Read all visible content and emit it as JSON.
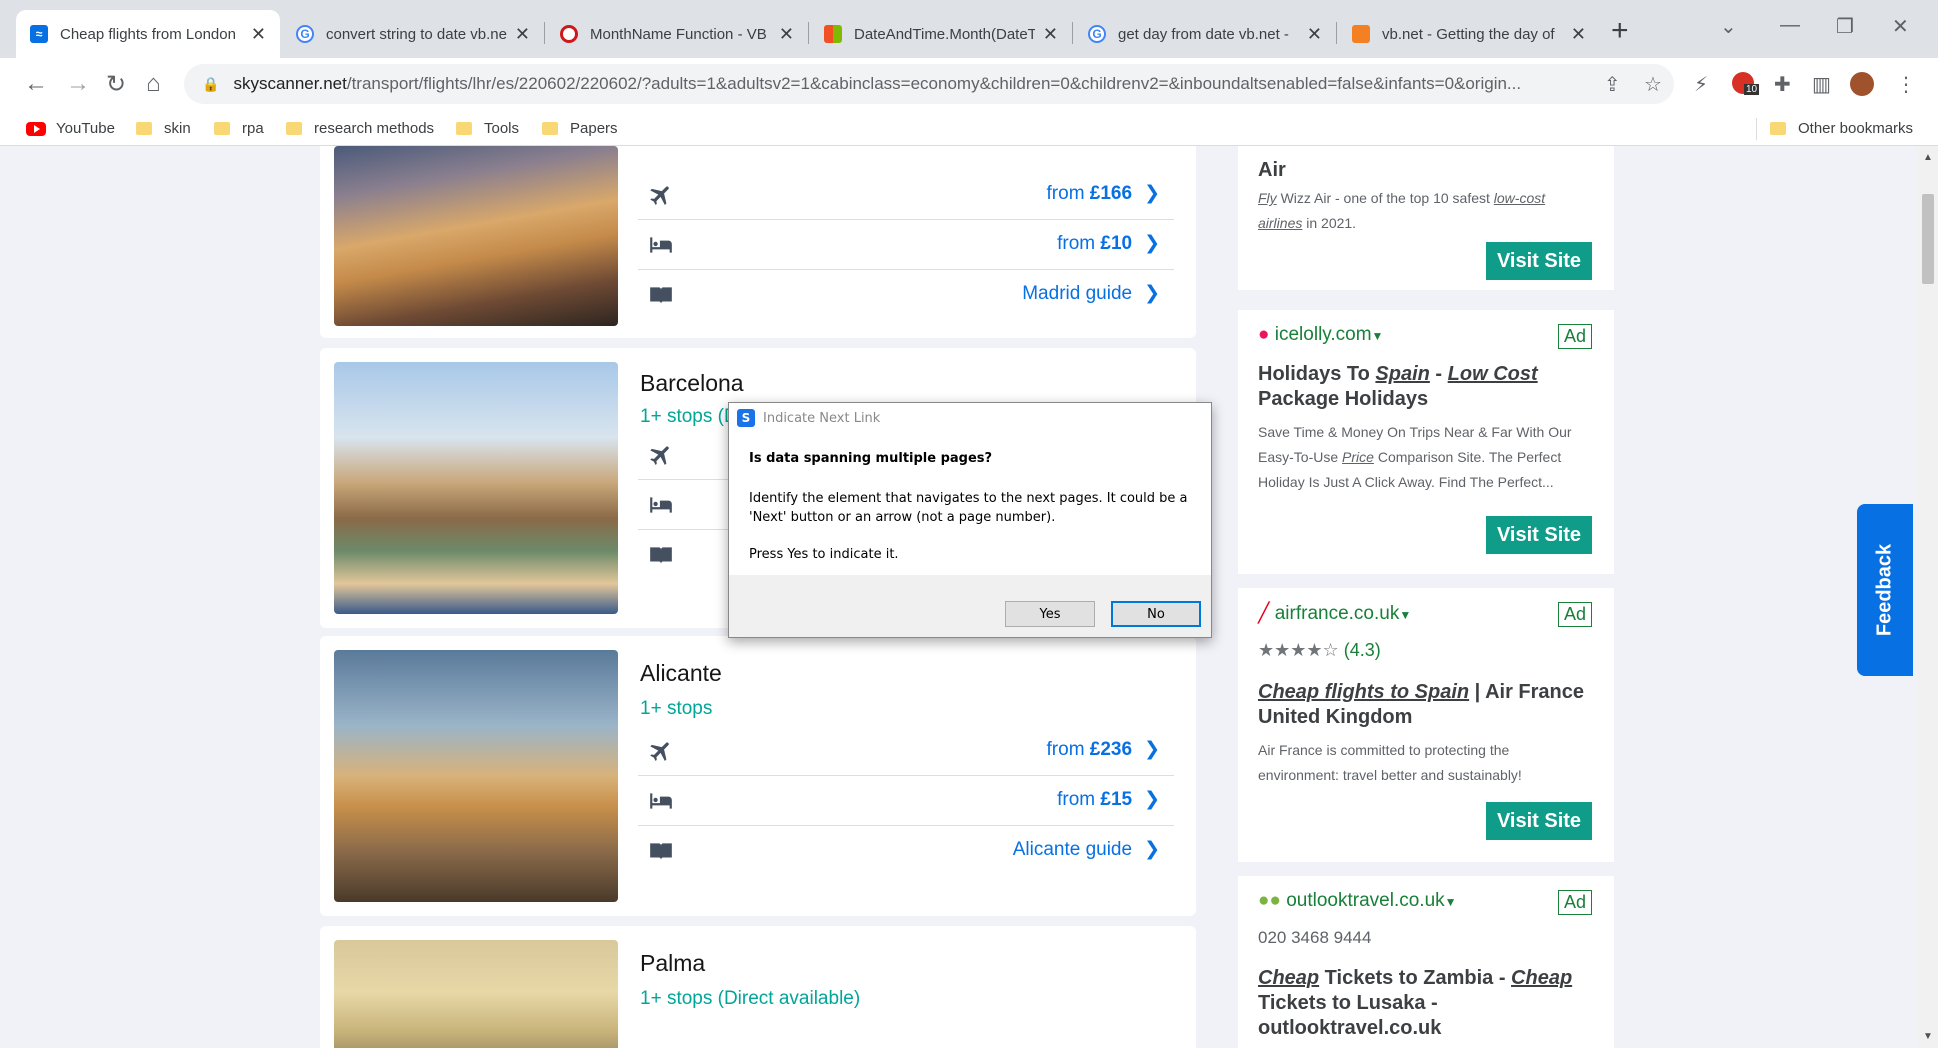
{
  "browser": {
    "tabs": [
      {
        "label": "Cheap flights from London",
        "favicon": "skyscanner-icon",
        "active": true
      },
      {
        "label": "convert string to date vb.ne",
        "favicon": "google-icon",
        "active": false
      },
      {
        "label": "MonthName Function - VB",
        "favicon": "opera-icon",
        "active": false
      },
      {
        "label": "DateAndTime.Month(DateT",
        "favicon": "microsoft-icon",
        "active": false
      },
      {
        "label": "get day from date vb.net -",
        "favicon": "google-icon",
        "active": false
      },
      {
        "label": "vb.net - Getting the day of",
        "favicon": "stackoverflow-icon",
        "active": false
      }
    ],
    "url_host": "skyscanner.net",
    "url_path": "/transport/flights/lhr/es/220602/220602/?adults=1&adultsv2=1&cabinclass=economy&children=0&childrenv2=&inboundaltsenabled=false&infants=0&origin...",
    "extension_badge": "10",
    "bookmarks": [
      "YouTube",
      "skin",
      "rpa",
      "research methods",
      "Tools",
      "Papers"
    ],
    "other_bookmarks": "Other bookmarks"
  },
  "destinations": [
    {
      "city": "",
      "stops": "",
      "flight": "from ",
      "flight_price": "£166",
      "hotel": "from ",
      "hotel_price": "£10",
      "guide": "Madrid guide"
    },
    {
      "city": "Barcelona",
      "stops": "1+ stops (D",
      "flight": "",
      "flight_price": "",
      "hotel": "",
      "hotel_price": "",
      "guide": ""
    },
    {
      "city": "Alicante",
      "stops": "1+ stops",
      "flight": "from ",
      "flight_price": "£236",
      "hotel": "from ",
      "hotel_price": "£15",
      "guide": "Alicante guide"
    },
    {
      "city": "Palma",
      "stops": "1+ stops (Direct available)"
    }
  ],
  "ads": {
    "wizz": {
      "heading": "Air",
      "body_pre": "Wizz Air - one of the top 10 safest ",
      "body_fly": "Fly",
      "body_link1": "low-cost",
      "body_link2": "airlines",
      "body_post": " in 2021.",
      "button": "Visit Site"
    },
    "icelolly": {
      "brand": "icelolly.com",
      "badge": "Ad",
      "heading_pre": "Holidays To ",
      "heading_link1": "Spain",
      "heading_mid": " - ",
      "heading_link2": "Low Cost",
      "heading_post": " Package Holidays",
      "body_pre": "Save Time & Money On Trips Near & Far With Our Easy-To-Use ",
      "body_link": "Price",
      "body_post": " Comparison Site. The Perfect Holiday Is Just A Click Away. Find The Perfect...",
      "button": "Visit Site"
    },
    "airfrance": {
      "brand": "airfrance.co.uk",
      "badge": "Ad",
      "rating": "(4.3)",
      "heading_link": "Cheap flights to Spain",
      "heading_post": " | Air France United Kingdom",
      "body": "Air France is committed to protecting the environment: travel better and sustainably!",
      "button": "Visit Site"
    },
    "outlook": {
      "brand": "outlooktravel.co.uk",
      "badge": "Ad",
      "phone": "020 3468 9444",
      "heading_link1": "Cheap",
      "heading_mid": " Tickets to Zambia - ",
      "heading_link2": "Cheap",
      "heading_post": " Tickets to Lusaka - outlooktravel.co.uk"
    }
  },
  "feedback": "Feedback",
  "dialog": {
    "title": "Indicate Next Link",
    "question": "Is data spanning multiple pages?",
    "text": "Identify the element that navigates to the next pages. It could be a 'Next' button or an arrow (not a page number).",
    "press": "Press Yes to indicate it.",
    "yes": "Yes",
    "no": "No"
  }
}
